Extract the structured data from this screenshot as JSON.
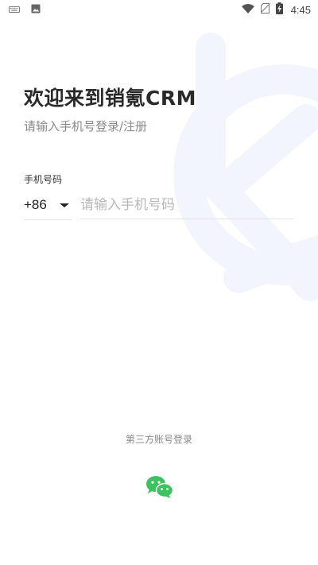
{
  "status_bar": {
    "left_icons": [
      "keyboard-icon",
      "image-icon"
    ],
    "right_icons": [
      "wifi-icon",
      "no-sim-icon",
      "battery-charging-icon"
    ],
    "time": "4:45"
  },
  "login": {
    "title": "欢迎来到销氪CRM",
    "subtitle": "请输入手机号登录/注册",
    "phone_label": "手机号码",
    "country_code": "+86",
    "phone_placeholder": "请输入手机号码",
    "phone_value": ""
  },
  "third_party": {
    "label": "第三方账号登录",
    "wechat_icon": "wechat-icon"
  },
  "colors": {
    "wechat_green": "#3cc35f",
    "watermark": "#f2f5fd",
    "placeholder": "#b8b8b8"
  }
}
